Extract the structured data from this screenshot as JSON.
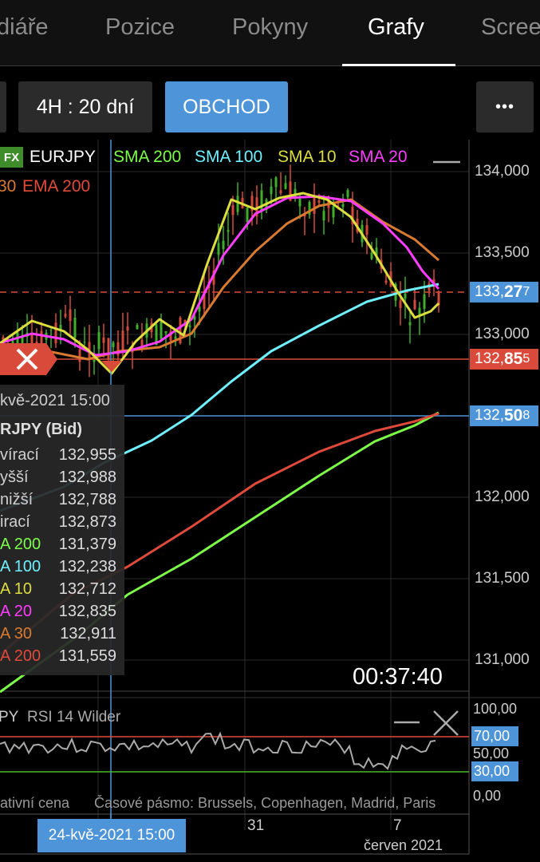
{
  "tabs": [
    {
      "label": "diáře"
    },
    {
      "label": "Pozice"
    },
    {
      "label": "Pokyny"
    },
    {
      "label": "Grafy"
    },
    {
      "label": "Scree"
    }
  ],
  "active_tab": "Grafy",
  "toolbar": {
    "timeframe_label": "4H : 20 dní",
    "trade_label": "OBCHOD",
    "more_label": "•••"
  },
  "legend": {
    "fx_badge": "FX",
    "symbol": "EURJPY",
    "sma200": "SMA 200",
    "sma100": "SMA 100",
    "sma10": "SMA 10",
    "sma20": "SMA 20",
    "ema30": "30",
    "ema200": "EMA 200",
    "minimize": "—"
  },
  "colors": {
    "sma200": "#7dff4a",
    "sma100": "#6ff0ff",
    "sma10": "#dddd40",
    "sma20": "#ff3dff",
    "ema30": "#d87a30",
    "ema200": "#e04a3a",
    "bull": "#3fae2a",
    "bear": "#d24a3a",
    "accent_blue": "#4d94d8",
    "alert_red": "#d94a3a"
  },
  "price_axis": [
    "134,000",
    "133,500",
    "133,000",
    "132,000",
    "131,500",
    "131,000"
  ],
  "price_tags": {
    "current": {
      "prefix": "133,",
      "bold": "27",
      "suffix": "7"
    },
    "alert": {
      "prefix": "132,",
      "bold": "85",
      "suffix": "5"
    },
    "level": {
      "prefix": "132,",
      "bold": "50",
      "suffix": "8"
    }
  },
  "countdown": "00:37:40",
  "tooltip": {
    "datetime": "kvě-2021 15:00",
    "title": "RJPY (Bid)",
    "rows": [
      {
        "name": "vírací",
        "value": "132,955",
        "color": "#cfcfcf"
      },
      {
        "name": "yšší",
        "value": "132,988",
        "color": "#cfcfcf"
      },
      {
        "name": "nižší",
        "value": "132,788",
        "color": "#cfcfcf"
      },
      {
        "name": "irací",
        "value": "132,873",
        "color": "#cfcfcf"
      },
      {
        "name": "A 200",
        "value": "131,379",
        "color": "#7dff4a"
      },
      {
        "name": "A 100",
        "value": "132,238",
        "color": "#6ff0ff"
      },
      {
        "name": "A 10",
        "value": "132,712",
        "color": "#dddd40"
      },
      {
        "name": "A 20",
        "value": "132,835",
        "color": "#ff3dff"
      },
      {
        "name": "A 30",
        "value": "132,911",
        "color": "#d87a30"
      },
      {
        "name": "A 200",
        "value": "131,559",
        "color": "#e04a3a"
      }
    ]
  },
  "rsi": {
    "title": "PY",
    "indicator": "RSI 14 Wilder",
    "axis": [
      "100,00",
      "70,00",
      "50,00",
      "30,00",
      "0,00"
    ],
    "minimize": "—"
  },
  "footer": {
    "price_type": "ativní cena",
    "timezone": "Časové pásmo: Brussels, Copenhagen, Madrid, Paris",
    "date_31": "31",
    "date_7": "7",
    "month": "červen 2021",
    "crosshair_date": "24-kvě-2021 15:00"
  }
}
